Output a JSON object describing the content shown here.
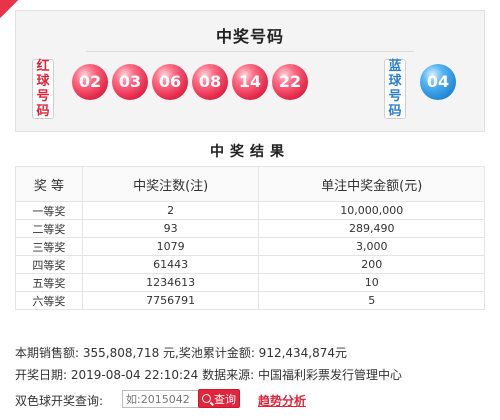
{
  "draw": {
    "title": "中奖号码",
    "red_label": "红球号码",
    "blue_label": "蓝球号码",
    "red_balls": [
      "02",
      "03",
      "06",
      "08",
      "14",
      "22"
    ],
    "blue_ball": "04"
  },
  "result": {
    "title": "中奖结果",
    "headers": [
      "奖 等",
      "中奖注数(注)",
      "单注中奖金额(元)"
    ],
    "rows": [
      [
        "一等奖",
        "2",
        "10,000,000"
      ],
      [
        "二等奖",
        "93",
        "289,490"
      ],
      [
        "三等奖",
        "1079",
        "3,000"
      ],
      [
        "四等奖",
        "61443",
        "200"
      ],
      [
        "五等奖",
        "1234613",
        "10"
      ],
      [
        "六等奖",
        "7756791",
        "5"
      ]
    ]
  },
  "info": {
    "sales": "本期销售额: 355,808,718 元,奖池累计金额: 912,434,874元",
    "date_source": "开奖日期: 2019-08-04 22:10:24 数据来源: 中国福利彩票发行管理中心"
  },
  "query": {
    "label": "双色球开奖查询:",
    "placeholder": "如:2015042",
    "button": "查询",
    "trend_link": "趋势分析"
  },
  "colors": {
    "red_accent": "#e4243b",
    "blue_accent": "#2a7fd0"
  }
}
